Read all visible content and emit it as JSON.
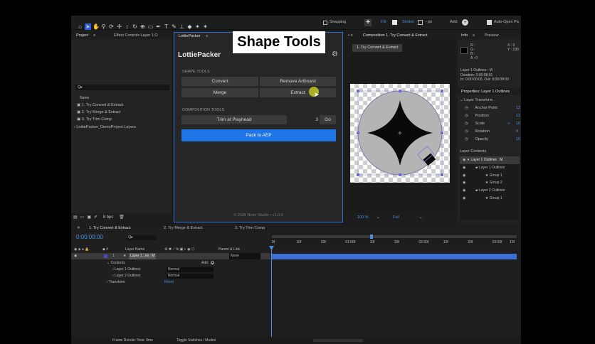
{
  "toolbar": {
    "snapping": "Snapping",
    "fill": "Fill:",
    "stroke": "Stroke:",
    "px": "- px",
    "add": "Add:",
    "auto_open": "Auto-Open Pa"
  },
  "overlay_title": "Shape Tools",
  "project": {
    "tab": "Project",
    "effect_tab": "Effect Controls Layer 1 O",
    "search_placeholder": "Q▸",
    "col_name": "Name",
    "items": [
      "1. Try Convert & Extract",
      "2. Try Merge & Extract",
      "3. Try Trim Comp",
      "LottiePacker_DemoProject Layers"
    ],
    "bpc": "8 bpc"
  },
  "plugin": {
    "tab": "LottiePacker",
    "title": "LottiePacker",
    "shape_section": "SHAPE TOOLS",
    "convert": "Convert",
    "remove_artboard": "Remove Artboard",
    "merge": "Merge",
    "extract": "Extract",
    "comp_section": "COMPOSITION TOOLS",
    "trim": "Trim at Playhead",
    "trim_value": "3",
    "go": "Go",
    "pack": "Pack to AEP",
    "footer": "© 2026 Niner Studio • v1.0.0"
  },
  "comp": {
    "tab": "Composition 1. Try Convert & Extract",
    "sub_tab": "1. Try Convert & Extract",
    "zoom": "100 %",
    "quality": "Full"
  },
  "info": {
    "tab": "Info",
    "preview_tab": "Preview",
    "r": "R :",
    "g": "G :",
    "b": "B :",
    "a": "A : 0",
    "x": "X : 3",
    "y": "Y : 230",
    "layer": "Layer 1 Outlines : M",
    "duration": "Duration: 0:00:08:01",
    "in_out": "In: 0:00:00:00, Out: 0:00:08:00"
  },
  "properties": {
    "tab": "Properties: Layer 1 Outlines",
    "transform": "Layer Transform",
    "rows": [
      "Anchor Point",
      "Position",
      "Scale",
      "Rotation",
      "Opacity"
    ],
    "vals": [
      "12",
      "12",
      "10",
      "0",
      "10"
    ],
    "contents": "Layer Contents",
    "tree": [
      "Layer 1 Outlines : M",
      "Layer 1 Outlines",
      "Group 1",
      "Group 2",
      "Layer 2 Outlines",
      "Group 1"
    ]
  },
  "timeline": {
    "tabs": [
      "1. Try Convert & Extract",
      "2. Try Merge & Extract",
      "3. Try Trim Comp"
    ],
    "time": "0:00:00:00",
    "search": "Q▸",
    "col_layer": "Layer Name",
    "col_parent": "Parent & Link",
    "layer_num": "1",
    "layer_name": "Layer 1...es : M",
    "parent": "None",
    "contents": "Contents",
    "add": "Add:",
    "sub_layers": [
      "Layer 1 Outlines",
      "Layer 2 Outlines"
    ],
    "mode": "Normal",
    "transform": "Transform",
    "reset": "Reset",
    "ticks": [
      "0f",
      "10f",
      "20f",
      "01:00f",
      "10f",
      "20f",
      "02:00f",
      "10f",
      "20f",
      "03:00f",
      "10f"
    ],
    "footer_left": "Frame Render Time: 0ms",
    "footer_right": "Toggle Switches / Modes"
  },
  "colors": {
    "accent": "#1f74e8",
    "blue_text": "#4c8fe0",
    "bar": "#3c6fd6"
  }
}
